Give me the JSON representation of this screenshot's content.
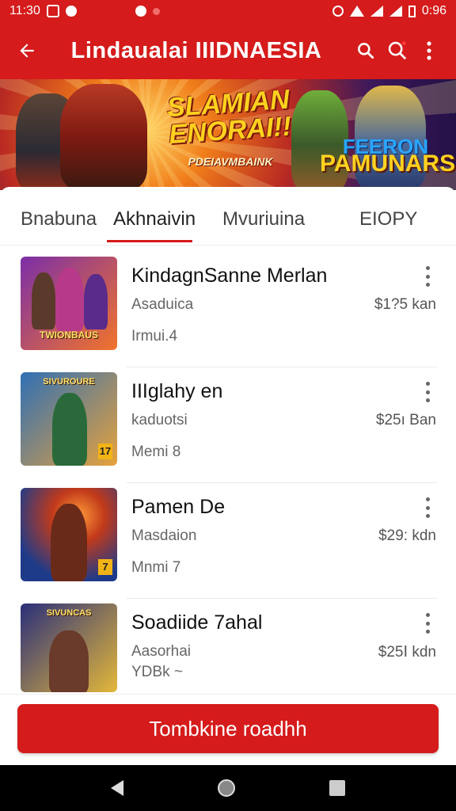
{
  "status_bar": {
    "time": "11:30",
    "time_right": "0:96"
  },
  "app_bar": {
    "title": "Lindaualai IIIDNAESIA",
    "back_icon": "arrow-left-icon",
    "search_icon": "search-icon",
    "search2_icon": "search-icon",
    "more_icon": "more-vertical-icon"
  },
  "banner": {
    "main_text": "SLAMIAN ENORAI!!",
    "sub_text": "PDEIAVMBAINK",
    "right_top": "FEERON",
    "right_bottom": "PAMUNARS"
  },
  "tabs": [
    {
      "label": "Bnabuna"
    },
    {
      "label": "Akhnaivin"
    },
    {
      "label": "Mvuriuina"
    },
    {
      "label": "EIOPY"
    }
  ],
  "active_tab": 1,
  "items": [
    {
      "title": "KindagnSanne Merlan",
      "subtitle": "Asaduica",
      "meta": "Irmui.4",
      "price": "$1?5 kan",
      "thumb_caption": "TWIONBAUS",
      "colors": [
        "#7b2fa8",
        "#f1742b"
      ]
    },
    {
      "title": "IIIglahy en",
      "subtitle": "kaduotsi",
      "meta": "Memi 8",
      "price": "$25ı Ban",
      "thumb_caption": "SIVUROURE",
      "colors": [
        "#2f6fb5",
        "#e7a23b"
      ]
    },
    {
      "title": "Pamen De",
      "subtitle": "Masdaion",
      "meta": "Mnmi 7",
      "price": "$29: kdn",
      "thumb_caption": "",
      "colors": [
        "#1e3b8a",
        "#ff6a2a"
      ]
    },
    {
      "title": "Soadiide 7ahal",
      "subtitle": "Aasorhai",
      "meta": "YDBk ~",
      "price": "$25Ⅰ kdn",
      "thumb_caption": "SIVUNCAS",
      "colors": [
        "#2a2f7a",
        "#e4b83a"
      ]
    }
  ],
  "cta": {
    "label": "Tombkine roadhh"
  },
  "brand_color": "#d51b1b"
}
